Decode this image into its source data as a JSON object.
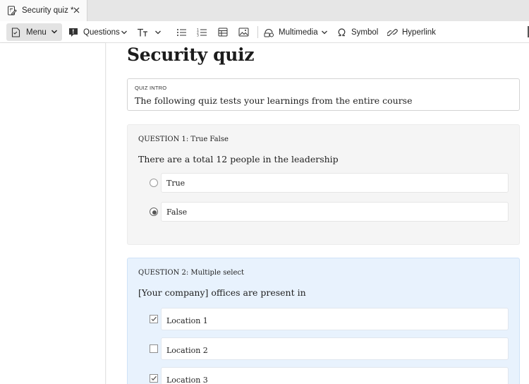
{
  "tab": {
    "title": "Security quiz *",
    "icon": "document-edit-icon"
  },
  "toolbar": {
    "menu_label": "Menu",
    "questions_label": "Questions",
    "multimedia_label": "Multimedia",
    "symbol_label": "Symbol",
    "hyperlink_label": "Hyperlink"
  },
  "document": {
    "title": "Security quiz",
    "intro": {
      "label": "QUIZ INTRO",
      "text": "The following quiz tests your learnings from the entire course"
    },
    "questions": [
      {
        "header": "QUESTION 1: True False",
        "text": "There are a total 12 people in the leadership",
        "type": "radio",
        "options": [
          {
            "label": "True",
            "selected": false
          },
          {
            "label": "False",
            "selected": true
          }
        ]
      },
      {
        "header": "QUESTION 2: Multiple select",
        "text": "[Your company] offices are present in",
        "type": "checkbox",
        "options": [
          {
            "label": "Location 1",
            "checked": true
          },
          {
            "label": "Location 2",
            "checked": false
          },
          {
            "label": "Location 3",
            "checked": true
          }
        ]
      }
    ]
  },
  "colors": {
    "question_active_bg": "#e8f2fd",
    "question_bg": "#f5f5f5",
    "tabbar_bg": "#e6e6e6",
    "menu_button_bg": "#e3e3e3"
  }
}
